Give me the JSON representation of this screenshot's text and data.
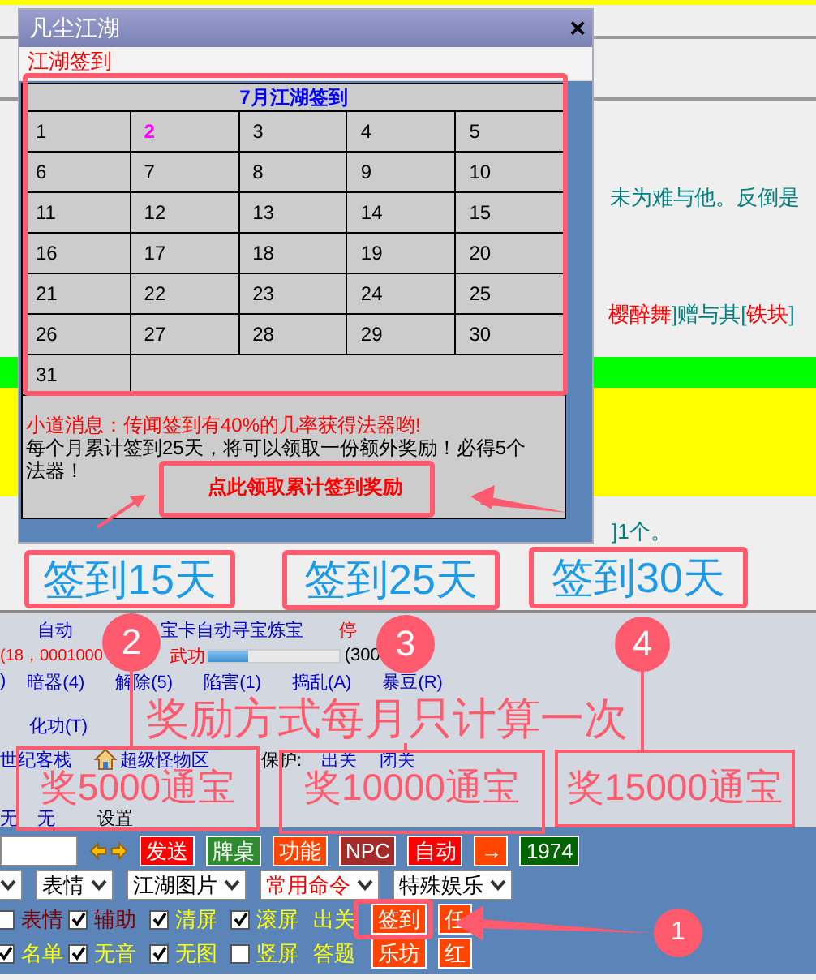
{
  "chat": [
    {
      "kind": "text",
      "segments": [
        {
          "text": "未为难与他。反倒是",
          "kind": "plain"
        }
      ]
    },
    {
      "kind": "text",
      "segments": [
        {
          "text": "樱醉舞",
          "kind": "item"
        },
        {
          "text": "]赠与其[",
          "kind": "plain"
        },
        {
          "text": "铁块",
          "kind": "item"
        },
        {
          "text": "]",
          "kind": "plain"
        }
      ]
    },
    {
      "kind": "green_bar"
    },
    {
      "kind": "yellow_band"
    },
    {
      "kind": "text",
      "segments": [
        {
          "text": "]1个。",
          "kind": "plain"
        }
      ]
    }
  ],
  "dialog": {
    "title": "凡尘江湖",
    "close": "×",
    "subtitle": "江湖签到",
    "calendar": {
      "title": "7月江湖签到",
      "days": [
        {
          "day": "1",
          "current": false
        },
        {
          "day": "2",
          "current": true
        },
        {
          "day": "3",
          "current": false
        },
        {
          "day": "4",
          "current": false
        },
        {
          "day": "5",
          "current": false
        },
        {
          "day": "6",
          "current": false
        },
        {
          "day": "7",
          "current": false
        },
        {
          "day": "8",
          "current": false
        },
        {
          "day": "9",
          "current": false
        },
        {
          "day": "10",
          "current": false
        },
        {
          "day": "11",
          "current": false
        },
        {
          "day": "12",
          "current": false
        },
        {
          "day": "13",
          "current": false
        },
        {
          "day": "14",
          "current": false
        },
        {
          "day": "15",
          "current": false
        },
        {
          "day": "16",
          "current": false
        },
        {
          "day": "17",
          "current": false
        },
        {
          "day": "18",
          "current": false
        },
        {
          "day": "19",
          "current": false
        },
        {
          "day": "20",
          "current": false
        },
        {
          "day": "21",
          "current": false
        },
        {
          "day": "22",
          "current": false
        },
        {
          "day": "23",
          "current": false
        },
        {
          "day": "24",
          "current": false
        },
        {
          "day": "25",
          "current": false
        },
        {
          "day": "26",
          "current": false
        },
        {
          "day": "27",
          "current": false
        },
        {
          "day": "28",
          "current": false
        },
        {
          "day": "29",
          "current": false
        },
        {
          "day": "30",
          "current": false
        },
        {
          "day": "31",
          "current": false
        }
      ]
    },
    "rumor": "小道消息：传闻签到有40%的几率获得法器哟!",
    "info": "每个月累计签到25天，将可以领取一份额外奖励！必得5个法器！",
    "claim_button": "点此领取累计签到奖励"
  },
  "panel": {
    "rows": [
      {
        "items": [
          {
            "kind": "link",
            "text": "自动"
          },
          {
            "kind": "link",
            "text": "宝卡自动寻宝炼宝"
          },
          {
            "kind": "alert",
            "text": "停"
          }
        ]
      },
      {
        "items": [
          {
            "kind": "alert",
            "text": "(18，0001000"
          },
          {
            "kind": "alert",
            "text": "武功"
          },
          {
            "kind": "meter",
            "level": 0.3
          },
          {
            "kind": "plain",
            "text": "(300"
          }
        ]
      },
      {
        "items": [
          {
            "kind": "link",
            "text": ")"
          },
          {
            "kind": "link",
            "text": "暗器(4)"
          },
          {
            "kind": "link",
            "text": "解除(5)"
          },
          {
            "kind": "link",
            "text": "陷害(1)"
          },
          {
            "kind": "link",
            "text": "捣乱(A)"
          },
          {
            "kind": "link",
            "text": "暴豆(R)"
          }
        ]
      },
      {
        "items": [
          {
            "kind": "link",
            "text": "化功(T)"
          }
        ]
      },
      {
        "items": [
          {
            "kind": "link",
            "text": "世纪客栈"
          },
          {
            "kind": "house"
          },
          {
            "kind": "link",
            "text": "超级怪物区"
          },
          {
            "kind": "plain",
            "text": "保护:"
          },
          {
            "kind": "link",
            "text": "出关"
          },
          {
            "kind": "link",
            "text": "闭关"
          }
        ]
      },
      {
        "items": [
          {
            "kind": "link",
            "text": "无"
          },
          {
            "kind": "link",
            "text": "无"
          },
          {
            "kind": "plain",
            "text": "设置"
          }
        ]
      }
    ]
  },
  "toolbar": {
    "buttons": [
      {
        "label": "发送",
        "color": "#ff0000"
      },
      {
        "label": "牌桌",
        "color": "#2e8b2e"
      },
      {
        "label": "功能",
        "color": "#ff4500"
      },
      {
        "label": "NPC",
        "color": "#a52a2a"
      },
      {
        "label": "自动",
        "color": "#ff0000"
      },
      {
        "label": "→",
        "color": "#ff4500"
      },
      {
        "label": "1974",
        "color": "#006400"
      }
    ],
    "selects": [
      {
        "kind": "cut"
      },
      {
        "kind": "normal",
        "label": "表情"
      },
      {
        "kind": "normal",
        "label": "江湖图片"
      },
      {
        "kind": "highlight",
        "label": "常用命令"
      },
      {
        "kind": "normal",
        "label": "特殊娱乐"
      }
    ],
    "option_rows": [
      [
        {
          "kind": "checkbox",
          "checked": false,
          "label": "表情",
          "color": "#800000"
        },
        {
          "kind": "checkbox",
          "checked": true,
          "label": "辅助",
          "color": "#800000"
        },
        {
          "kind": "checkbox",
          "checked": true,
          "label": "清屏",
          "color": "#ffff00"
        },
        {
          "kind": "checkbox",
          "checked": true,
          "label": "滚屏",
          "color": "#ffff00"
        },
        {
          "kind": "link",
          "label": "出关"
        },
        {
          "kind": "button",
          "label": "签到"
        },
        {
          "kind": "button",
          "label": "任"
        }
      ],
      [
        {
          "kind": "checkbox",
          "checked": true,
          "label": "名单",
          "color": "#ffff00"
        },
        {
          "kind": "checkbox",
          "checked": true,
          "label": "无音",
          "color": "#ffff00"
        },
        {
          "kind": "checkbox",
          "checked": true,
          "label": "无图",
          "color": "#ffff00"
        },
        {
          "kind": "checkbox",
          "checked": false,
          "label": "竖屏",
          "color": "#ffff00"
        },
        {
          "kind": "link",
          "label": "答题"
        },
        {
          "kind": "button",
          "label": "乐坊"
        },
        {
          "kind": "button",
          "label": "红"
        }
      ]
    ]
  },
  "annotations": {
    "callouts": [
      "1",
      "2",
      "3",
      "4"
    ],
    "day_labels": [
      "签到15天",
      "签到25天",
      "签到30天"
    ],
    "note": "奖励方式每月只计算一次",
    "rewards": [
      "奖5000通宝",
      "奖10000通宝",
      "奖15000通宝"
    ]
  }
}
